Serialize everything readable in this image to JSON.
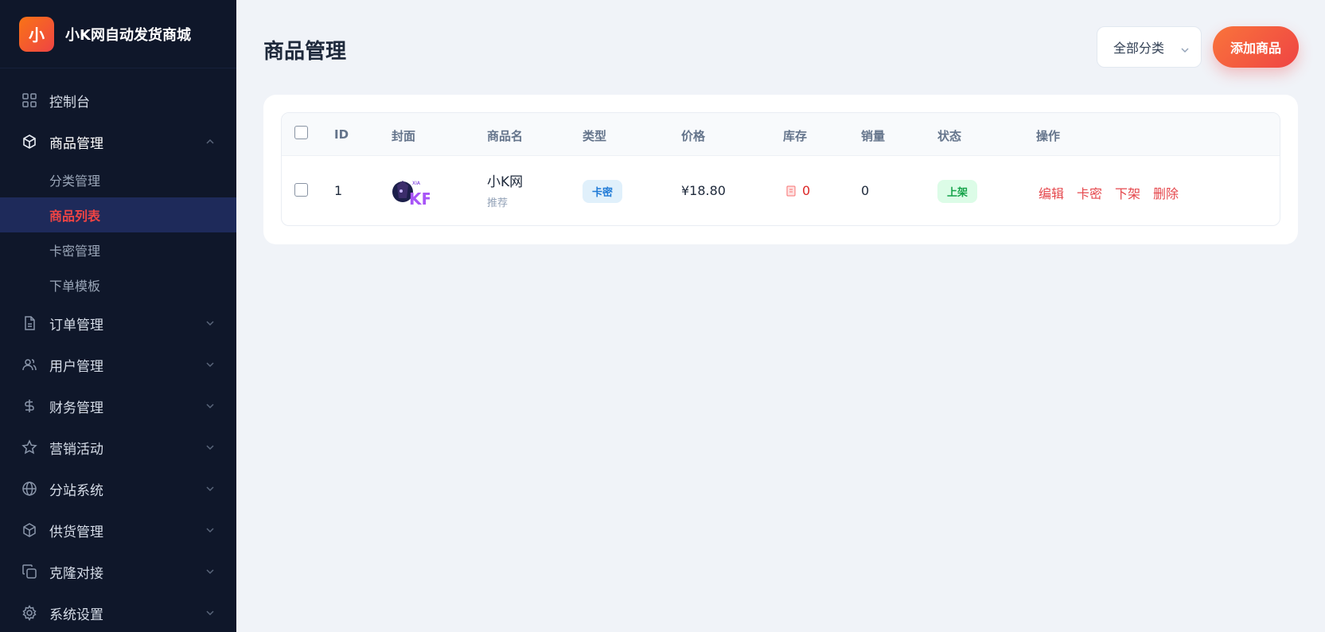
{
  "brand": {
    "logo_char": "小",
    "name": "小K网自动发货商城"
  },
  "sidebar": {
    "items": [
      {
        "label": "控制台",
        "icon": "dashboard-icon"
      },
      {
        "label": "商品管理",
        "icon": "cube-icon",
        "expanded": true,
        "children": [
          {
            "label": "分类管理"
          },
          {
            "label": "商品列表",
            "active": true
          },
          {
            "label": "卡密管理"
          },
          {
            "label": "下单模板"
          }
        ]
      },
      {
        "label": "订单管理",
        "icon": "document-icon"
      },
      {
        "label": "用户管理",
        "icon": "users-icon"
      },
      {
        "label": "财务管理",
        "icon": "dollar-icon"
      },
      {
        "label": "营销活动",
        "icon": "star-icon"
      },
      {
        "label": "分站系统",
        "icon": "globe-icon"
      },
      {
        "label": "供货管理",
        "icon": "box-icon"
      },
      {
        "label": "克隆对接",
        "icon": "copy-icon"
      },
      {
        "label": "系统设置",
        "icon": "gear-icon"
      }
    ]
  },
  "header": {
    "title": "商品管理",
    "category_select": "全部分类",
    "add_button": "添加商品"
  },
  "table": {
    "columns": [
      "ID",
      "封面",
      "商品名",
      "类型",
      "价格",
      "库存",
      "销量",
      "状态",
      "操作"
    ],
    "rows": [
      {
        "id": "1",
        "cover_text": "KF",
        "name": "小K网",
        "sub": "推荐",
        "type": "卡密",
        "price": "¥18.80",
        "stock": "0",
        "sales": "0",
        "status": "上架",
        "actions": [
          "编辑",
          "卡密",
          "下架",
          "删除"
        ]
      }
    ]
  },
  "colors": {
    "sidebar_bg": "#0f172a",
    "accent": "#ef4444",
    "active_bg": "#1e2a5a",
    "type_tag": "#1f7ad6",
    "status_tag": "#16a34a"
  }
}
